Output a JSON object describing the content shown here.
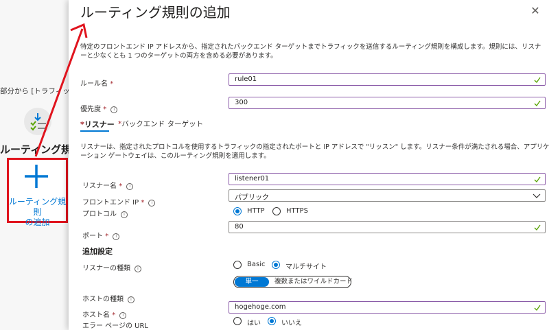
{
  "background": {
    "breadcrumb_text": "部分から [トラフィック フ",
    "heading": "ルーティング規則",
    "callout_label_line1": "ルーティング規則",
    "callout_label_line2": "の追加"
  },
  "blade": {
    "title": "ルーティング規則の追加",
    "description": "特定のフロントエンド IP アドレスから、指定されたバックエンド ターゲットまでトラフィックを送信するルーティング規則を構成します。規則には、リスナーと少なくとも 1 つのターゲットの両方を含める必要があります。",
    "rule_name_label": "ルール名",
    "rule_name_value": "rule01",
    "priority_label": "優先度",
    "priority_value": "300",
    "required_mark": "*",
    "tabs": [
      {
        "label": "リスナー",
        "prefix": "*"
      },
      {
        "label": "バックエンド ターゲット",
        "prefix": "*"
      }
    ],
    "listener_description": "リスナーは、指定されたプロトコルを使用するトラフィックの指定されたポートと IP アドレスで \"リッスン\" します。リスナー条件が満たされる場合、アプリケーション ゲートウェイは、このルーティング規則を適用します。",
    "listener_name_label": "リスナー名",
    "listener_name_value": "listener01",
    "frontend_ip_label": "フロントエンド IP",
    "frontend_ip_value": "パブリック",
    "protocol_label": "プロトコル",
    "protocol_options": [
      "HTTP",
      "HTTPS"
    ],
    "port_label": "ポート",
    "port_value": "80",
    "additional_settings_label": "追加設定",
    "listener_type_label": "リスナーの種類",
    "listener_type_options": [
      "Basic",
      "マルチサイト"
    ],
    "host_type_label": "ホストの種類",
    "host_type_options": [
      "単一",
      "複数またはワイルドカード"
    ],
    "host_name_label": "ホスト名",
    "host_name_value": "hogehoge.com",
    "error_page_label": "エラー ページの URL",
    "error_page_options": [
      "はい",
      "いいえ"
    ],
    "info_glyph": "i",
    "close_glyph": "✕"
  },
  "colors": {
    "accent": "#0078d4",
    "highlight_box": "#e0141e",
    "valid_check": "#57a300",
    "field_border": "#8a5aa8"
  }
}
